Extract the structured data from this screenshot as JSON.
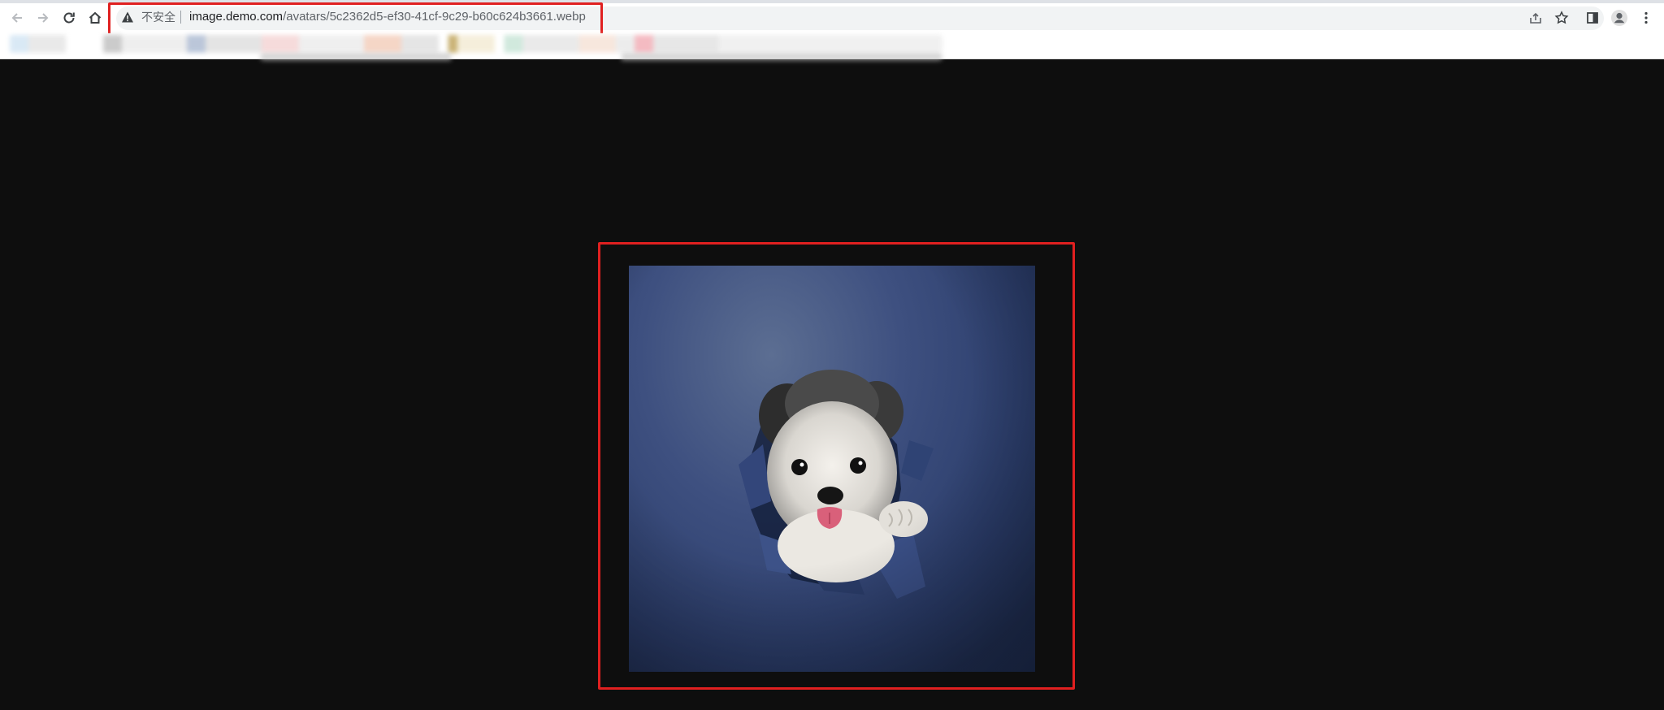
{
  "browser": {
    "address_bar": {
      "security_label": "不安全",
      "url_host": "image.demo.com",
      "url_path": "/avatars/5c2362d5-ef30-41cf-9c29-b60c624b3661.webp"
    },
    "nav_icons": [
      "back-arrow-icon",
      "forward-arrow-icon",
      "reload-icon",
      "home-icon"
    ],
    "toolbar_icons": [
      "share-icon",
      "bookmark-star-icon",
      "side-panel-icon",
      "profile-avatar-icon",
      "more-menu-icon"
    ]
  },
  "viewer": {
    "image_format": "webp",
    "image_subject": "small dog poking head through torn blue paper"
  },
  "colors": {
    "page_background": "#0e0e0e",
    "highlight": "#e02020",
    "photo_blue": "#2b3d6b"
  }
}
